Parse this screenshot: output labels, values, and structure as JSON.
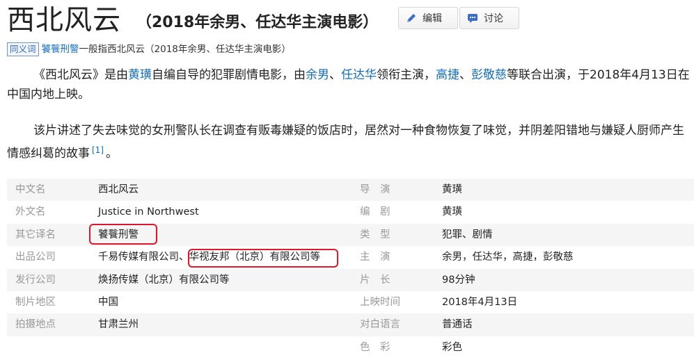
{
  "header": {
    "title": "西北风云",
    "subtitle": "（2018年余男、任达华主演电影）",
    "edit_label": "编辑",
    "discuss_label": "讨论"
  },
  "synonym": {
    "tag": "同义词",
    "link": "饕餮刑警",
    "rest": "一般指西北风云（2018年余男、任达华主演电影）"
  },
  "intro": {
    "p1": {
      "t1": "《西北风云》是由",
      "a1": "黄璜",
      "t2": "自编自导的犯罪剧情电影，由",
      "a2": "余男",
      "t3": "、",
      "a3": "任达华",
      "t4": "领衔主演，",
      "a4": "高捷",
      "t5": "、",
      "a5": "彭敬慈",
      "t6": "等联合出演，于2018年4月13日在中国内地上映。"
    },
    "p2": {
      "text": "该片讲述了失去味觉的女刑警队长在调查有贩毒嫌疑的饭店时，居然对一种食物恢复了味觉，并阴差阳错地与嫌疑人厨师产生情感纠葛的故事",
      "ref": "[1]",
      "end": "。"
    }
  },
  "info": {
    "rows": [
      {
        "l_label": "中文名",
        "l_value": "西北风云",
        "r_label": "导　演",
        "r_value": "黄璜"
      },
      {
        "l_label": "外文名",
        "l_value": "Justice in Northwest",
        "r_label": "编　剧",
        "r_value": "黄璜"
      },
      {
        "l_label": "其它译名",
        "l_value": "饕餮刑警",
        "r_label": "类　型",
        "r_value": "犯罪、剧情"
      },
      {
        "l_label": "出品公司",
        "l_value_a": "千易传媒有限公司、",
        "l_value_b": "华视友邦（北京）有限公司等",
        "r_label": "主　演",
        "r_value": "余男，任达华，高捷，彭敬慈"
      },
      {
        "l_label": "发行公司",
        "l_value": "焕扬传媒（北京）有限公司等",
        "r_label": "片　长",
        "r_value": "98分钟"
      },
      {
        "l_label": "制片地区",
        "l_value": "中国",
        "r_label": "上映时间",
        "r_value": "2018年4月13日"
      },
      {
        "l_label": "拍摄地点",
        "l_value": "甘肃兰州",
        "r_label": "对白语言",
        "r_value": "普通话"
      },
      {
        "l_label": "",
        "l_value": "",
        "r_label": "色　彩",
        "r_value": "彩色"
      }
    ]
  },
  "colors": {
    "link": "#136ec2",
    "highlight": "#e0152a",
    "label": "#999999"
  },
  "icons": {
    "edit": "pencil-icon",
    "discuss": "chat-bubble-icon"
  }
}
